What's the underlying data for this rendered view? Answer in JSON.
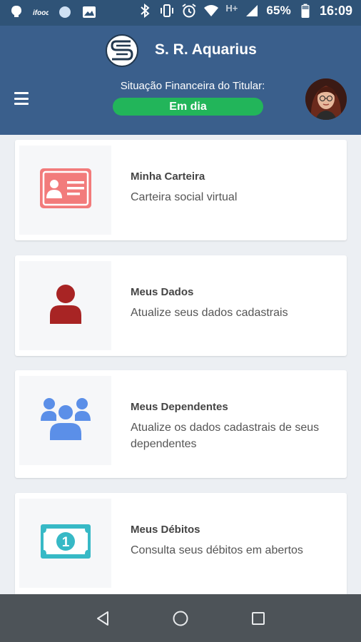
{
  "status_bar": {
    "icons_left": [
      "notification-icon",
      "app-icon",
      "circle-icon",
      "image-icon"
    ],
    "icons_right": [
      "bluetooth-icon",
      "vibrate-icon",
      "alarm-icon",
      "wifi-icon",
      "signal-icon",
      "battery-icon"
    ],
    "network": "H+",
    "battery": "65%",
    "time": "16:09"
  },
  "header": {
    "app_title": "S. R. Aquarius",
    "fin_label": "Situação Financeira do Titular:",
    "status": "Em dia",
    "status_color": "#22b55a",
    "bg_color": "#3a5f8c"
  },
  "cards": [
    {
      "title": "Minha Carteira",
      "subtitle": "Carteira social virtual",
      "icon": "id-card-icon",
      "icon_color": "#f27b7b"
    },
    {
      "title": "Meus Dados",
      "subtitle": "Atualize seus dados cadastrais",
      "icon": "user-icon",
      "icon_color": "#a82424"
    },
    {
      "title": "Meus Dependentes",
      "subtitle": "Atualize os dados cadastrais de seus dependentes",
      "icon": "group-icon",
      "icon_color": "#5b8fe8"
    },
    {
      "title": "Meus Débitos",
      "subtitle": "Consulta seus débitos em abertos",
      "icon": "banknote-icon",
      "icon_color": "#37b9c6"
    }
  ],
  "nav": [
    "back-icon",
    "home-icon",
    "recents-icon"
  ]
}
